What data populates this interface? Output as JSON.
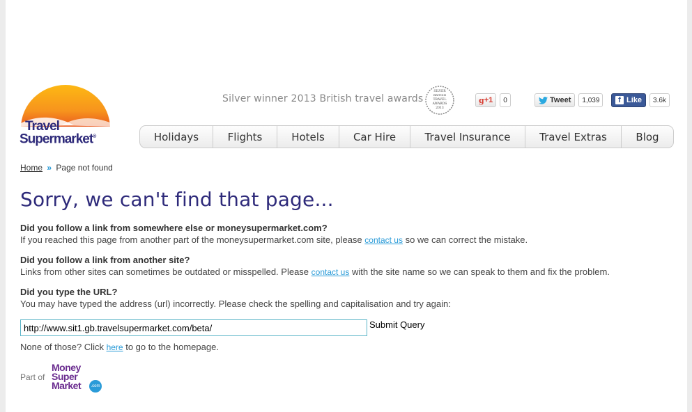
{
  "logo": {
    "line1": "Travel",
    "line2": "Supermarket",
    "reg": "®"
  },
  "award": {
    "text": "Silver winner 2013 British travel awards",
    "badge_lines": [
      "SILVER",
      "BRITISH",
      "TRAVEL",
      "AWARDS",
      "2013"
    ]
  },
  "social": {
    "gplus_label": "+1",
    "gplus_count": "0",
    "tweet_label": "Tweet",
    "tweet_count": "1,039",
    "like_label": "Like",
    "like_count": "3.6k"
  },
  "nav": [
    {
      "label": "Holidays"
    },
    {
      "label": "Flights"
    },
    {
      "label": "Hotels"
    },
    {
      "label": "Car Hire"
    },
    {
      "label": "Travel Insurance"
    },
    {
      "label": "Travel Extras"
    },
    {
      "label": "Blog"
    }
  ],
  "breadcrumb": {
    "home": "Home",
    "separator": "»",
    "current": "Page not found"
  },
  "title": "Sorry, we can't find that page...",
  "sections": [
    {
      "question": "Did you follow a link from somewhere else or moneysupermarket.com?",
      "before": "If you reached this page from another part of the moneysupermarket.com site, please ",
      "link": "contact us",
      "after": " so we can correct the mistake."
    },
    {
      "question": "Did you follow a link from another site?",
      "before": "Links from other sites can sometimes be outdated or misspelled. Please ",
      "link": "contact us",
      "after": " with the site name so we can speak to them and fix the problem."
    },
    {
      "question": "Did you type the URL?",
      "before": "You may have typed the address (url) incorrectly. Please check the spelling and capitalisation and try again:",
      "link": "",
      "after": ""
    }
  ],
  "search": {
    "value": "http://www.sit1.gb.travelsupermarket.com/beta/",
    "submit": "Submit Query"
  },
  "none": {
    "before": "None of those? Click ",
    "link": "here",
    "after": " to go to the homepage."
  },
  "footer": {
    "part_of": "Part of",
    "brand_lines": [
      "Money",
      "Super",
      "Market"
    ],
    "brand_dot": ".com"
  },
  "colors": {
    "brand_navy": "#2e2a7a",
    "link_blue": "#2a9bd8",
    "msm_purple": "#6a2c8f",
    "sun_orange": "#f7941d"
  }
}
